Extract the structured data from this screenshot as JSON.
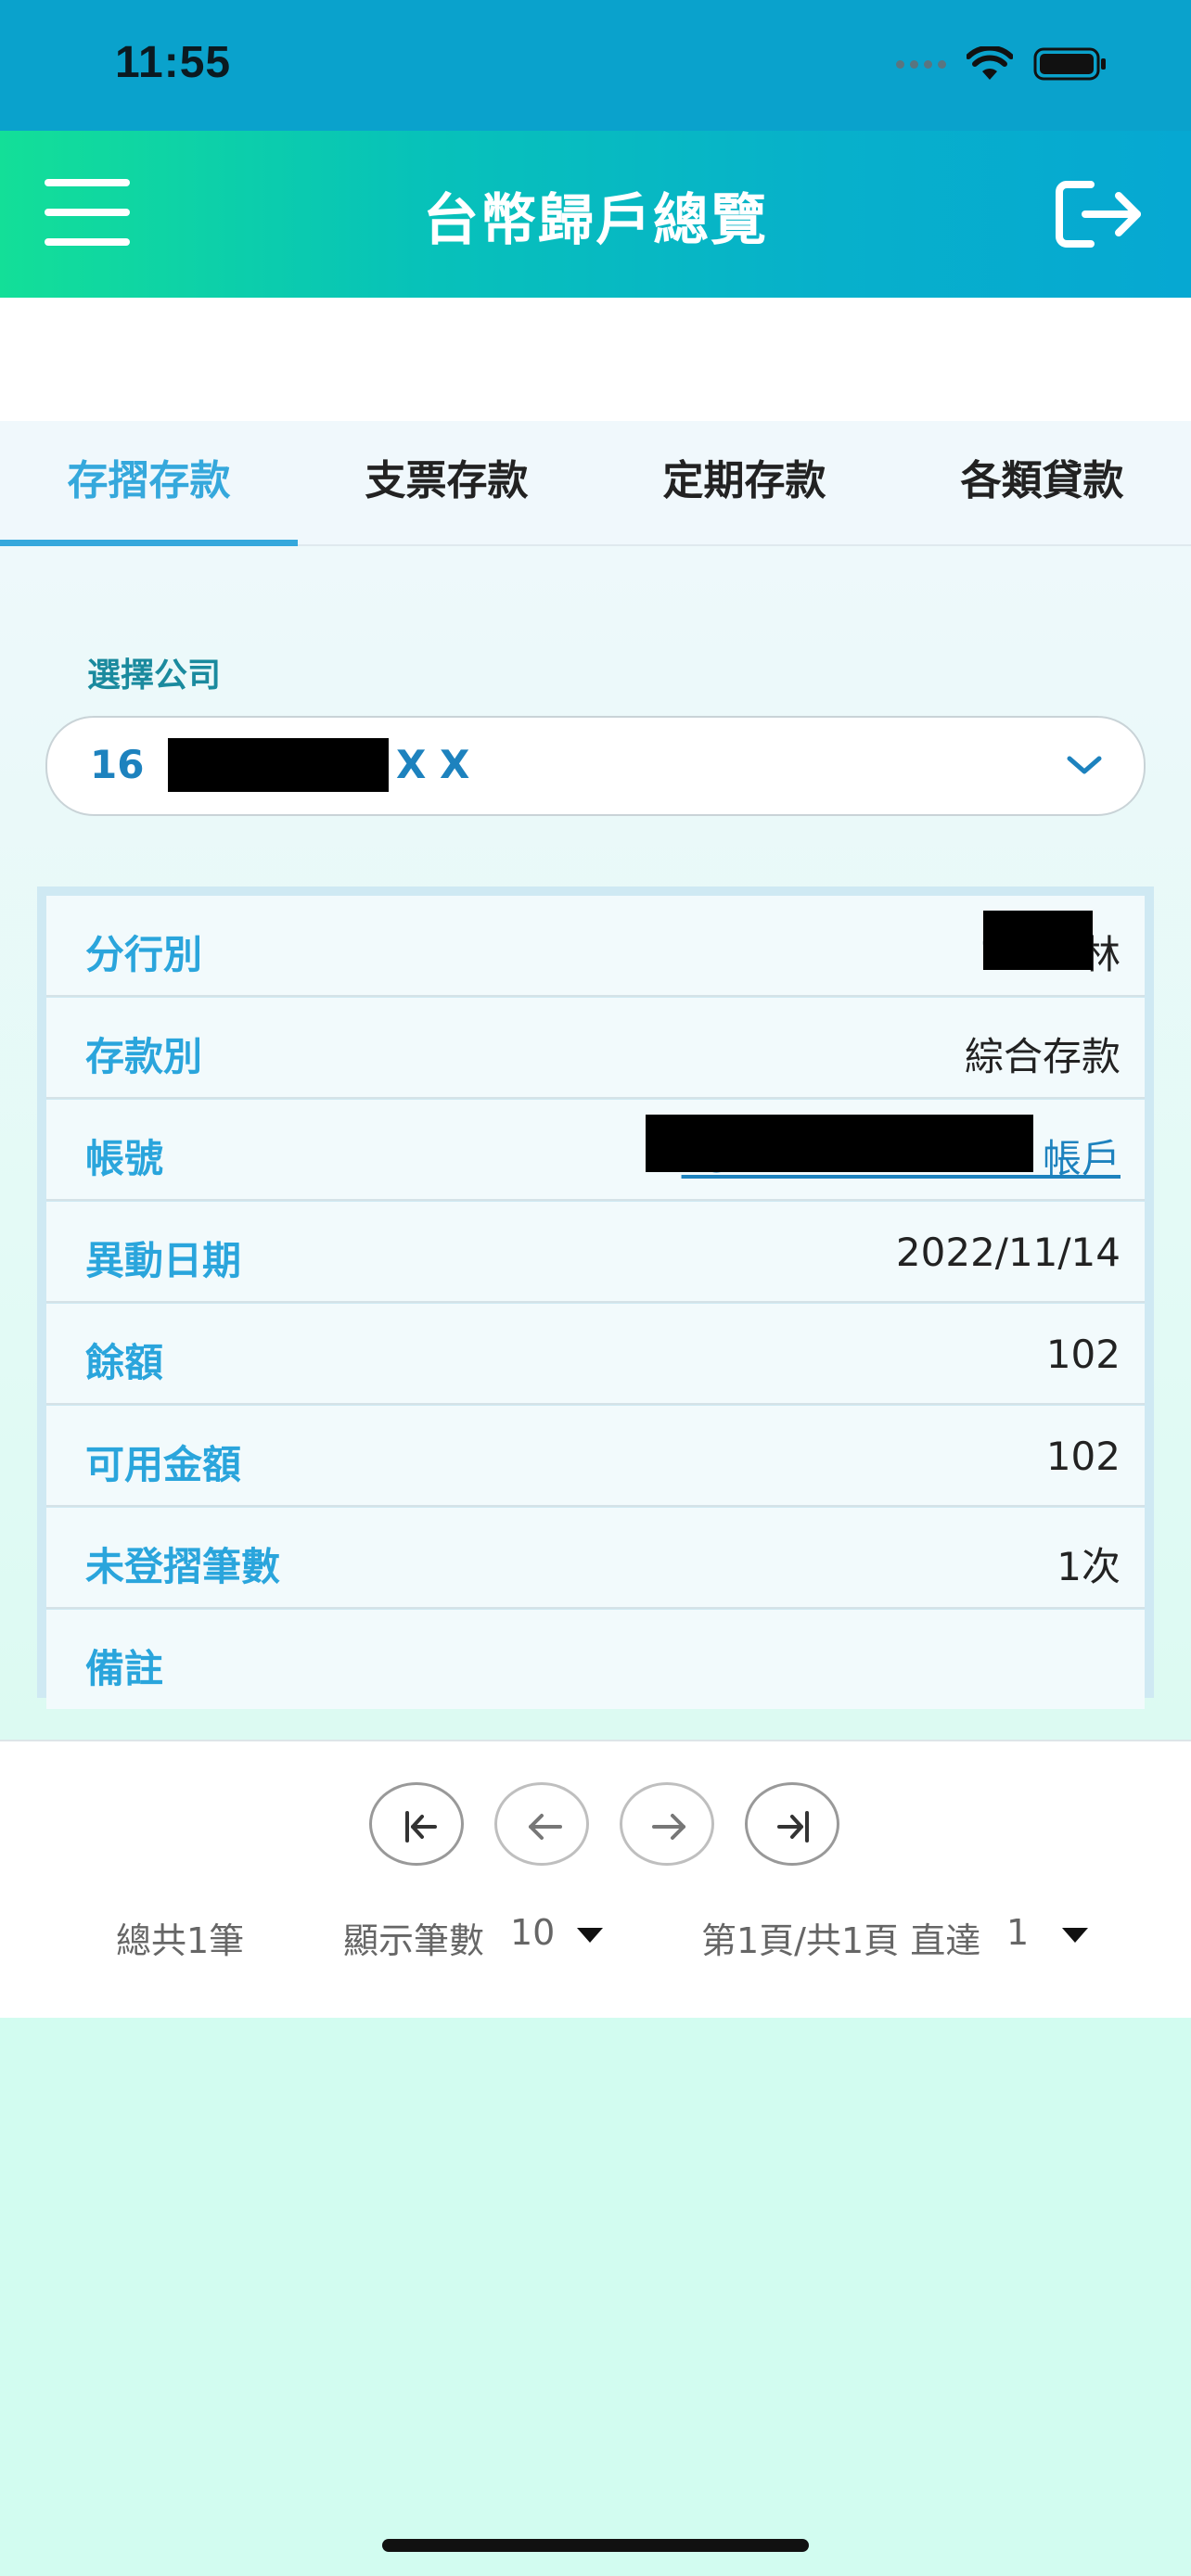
{
  "status_bar": {
    "time": "11:55"
  },
  "header": {
    "title": "台幣歸戶總覽"
  },
  "tabs": [
    {
      "label": "存摺存款",
      "active": true
    },
    {
      "label": "支票存款",
      "active": false
    },
    {
      "label": "定期存款",
      "active": false
    },
    {
      "label": "各類貸款",
      "active": false
    }
  ],
  "company_select": {
    "label": "選擇公司",
    "value_prefix": "16",
    "value_suffix": "X X"
  },
  "details": [
    {
      "label": "分行別",
      "value": "1　　林"
    },
    {
      "label": "存款別",
      "value": "綜合存款"
    },
    {
      "label": "帳號",
      "value": "13　　　　　　　　帳戶"
    },
    {
      "label": "異動日期",
      "value": "2022/11/14"
    },
    {
      "label": "餘額",
      "value": "102"
    },
    {
      "label": "可用金額",
      "value": "102"
    },
    {
      "label": "未登摺筆數",
      "value": "1次"
    },
    {
      "label": "備註",
      "value": ""
    }
  ],
  "pagination": {
    "total": "總共1筆",
    "page_size_label": "顯示筆數",
    "page_size": "10",
    "page_info": "第1頁/共1頁 直達",
    "goto_page": "1"
  },
  "colors": {
    "accent": "#35a8dc",
    "header_start": "#13df98",
    "header_end": "#06a8d2",
    "background": "#d2fcf0"
  }
}
